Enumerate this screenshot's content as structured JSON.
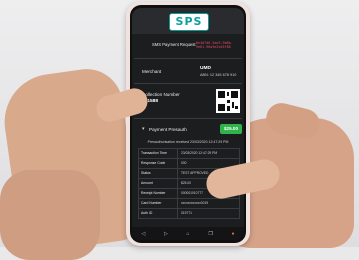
{
  "app": {
    "logo_text": "SPS"
  },
  "request": {
    "title": "SMS Payment Request",
    "id": "6e4d7d6-5ae5-9b6b-9e61-96a5e2e45f88"
  },
  "merchant": {
    "label": "Merchant",
    "name": "UMD",
    "abn": "ABN: 12 345 678 910"
  },
  "collection": {
    "label": "Collection Number",
    "number": "791588"
  },
  "payment": {
    "label": "Payment Presauth",
    "amount": "$25.00",
    "note": "Presauthorisation received 23/03/2020 12:47:29 PM",
    "rows": [
      {
        "key": "Transaction Time",
        "value": "23/03/2020 12:47:29 PM"
      },
      {
        "key": "Response Code",
        "value": "000"
      },
      {
        "key": "Status",
        "value": "TEST APPROVED"
      },
      {
        "key": "Amount",
        "value": "$25.00"
      },
      {
        "key": "Receipt Number",
        "value": "000001010777"
      },
      {
        "key": "Card Number",
        "value": "xxxxxxxxxxxx0019"
      },
      {
        "key": "Auth ID",
        "value": "019771"
      }
    ]
  },
  "nav": {
    "items": [
      {
        "icon": "back-icon",
        "glyph": "◁"
      },
      {
        "icon": "forward-icon",
        "glyph": "▷"
      },
      {
        "icon": "home-icon",
        "glyph": "⌂"
      },
      {
        "icon": "tabs-icon",
        "glyph": "❐"
      },
      {
        "icon": "brave-lion-icon",
        "glyph": "●"
      }
    ]
  },
  "colors": {
    "brand": "#0aa29b",
    "accent_amount": "#2fb34a",
    "request_id": "#e04a68",
    "active_nav": "#ee6b33"
  }
}
